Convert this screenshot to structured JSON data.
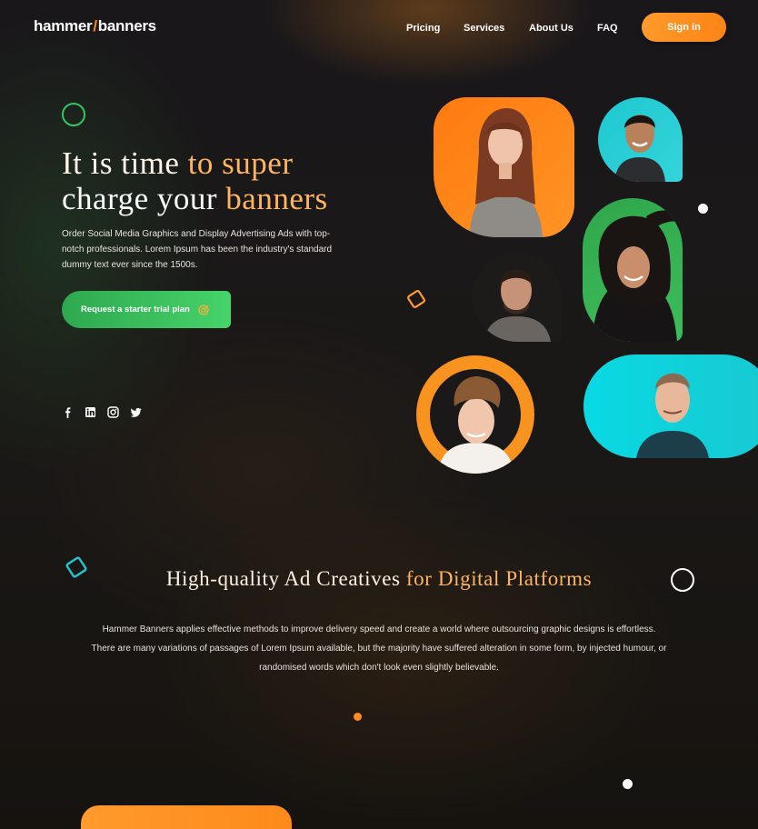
{
  "header": {
    "logo": {
      "left": "hammer",
      "slash": "/",
      "right": "banners"
    },
    "nav": [
      "Pricing",
      "Services",
      "About Us",
      "FAQ"
    ],
    "signin_label": "Sign in"
  },
  "hero": {
    "title_parts": [
      "It is time ",
      "to super",
      "charge your ",
      "banners"
    ],
    "description": "Order Social Media Graphics and Display Advertising Ads with top-notch professionals. Lorem Ipsum has been the industry's standard dummy text ever since the 1500s.",
    "cta_label": "Request a starter trial plan",
    "cta_icon": "target-icon",
    "social_icons": [
      "facebook-icon",
      "linkedin-icon",
      "instagram-icon",
      "twitter-icon"
    ]
  },
  "section": {
    "title_parts": [
      "High-quality Ad Creatives ",
      "for Digital Platforms"
    ],
    "description": "Hammer Banners applies effective methods to improve delivery speed and create a world where outsourcing graphic designs is effortless. There are many variations of passages of Lorem Ipsum available, but the majority have suffered alteration in some form, by injected humour, or randomised words which don't look even slightly believable."
  },
  "colors": {
    "accent_orange": "#ff8c1e",
    "accent_green": "#35c45f",
    "accent_cyan": "#1ec7cf",
    "background": "#1a1816"
  }
}
